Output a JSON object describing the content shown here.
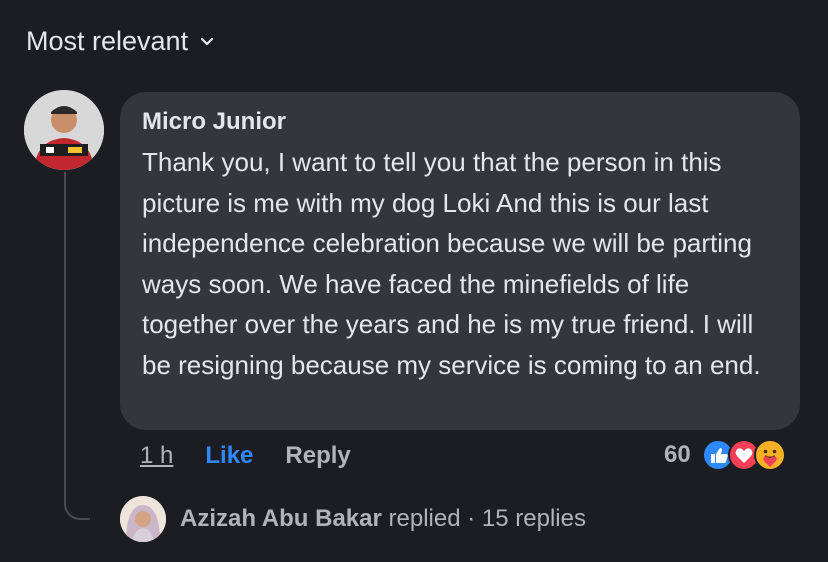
{
  "sort": {
    "label": "Most relevant"
  },
  "comment": {
    "author": "Micro Junior",
    "text": "Thank you, I want to tell you that the person in this picture is me with my dog Loki And this is our last independence celebration because we will be parting ways soon.  We have faced the minefields of life together over the years and he is my true friend.  I will be resigning because my service is coming to an end.",
    "time": "1 h",
    "like_label": "Like",
    "reply_label": "Reply",
    "reaction_count": "60",
    "reaction_icons": [
      "like-icon",
      "love-icon",
      "care-icon"
    ]
  },
  "reply_summary": {
    "name": "Azizah Abu Bakar",
    "action": "replied",
    "separator": "·",
    "count": "15 replies"
  },
  "colors": {
    "background": "#1c1d22",
    "bubble": "#35363b",
    "like_blue": "#2e89ff",
    "love_red": "#f33e58",
    "care_yellow": "#f7b125"
  }
}
